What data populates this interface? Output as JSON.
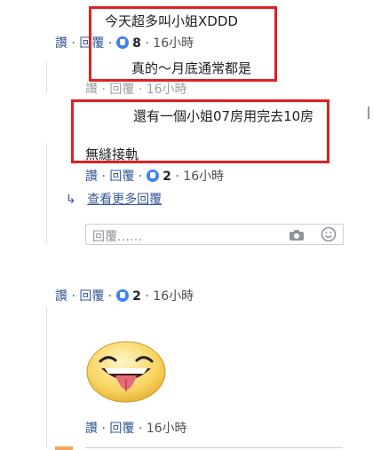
{
  "thread": {
    "comment1": {
      "text": "今天超多叫小姐XDDD",
      "meta": {
        "like": "讚",
        "reply": "回覆",
        "reactions": "8",
        "time": "16小時"
      }
    },
    "comment2": {
      "text": "真的～月底通常都是",
      "meta": {
        "like": "讚",
        "reply": "回覆",
        "time": "16小時"
      }
    },
    "comment3": {
      "text": "還有一個小姐07房用完去10房",
      "text2": "無縫接軌",
      "meta": {
        "like": "讚",
        "reply": "回覆",
        "reactions": "2",
        "time": "16小時"
      }
    },
    "more_replies": "查看更多回覆",
    "reply_input": {
      "placeholder": "回覆……"
    },
    "comment4": {
      "meta": {
        "like": "讚",
        "reply": "回覆",
        "reactions": "2",
        "time": "16小時"
      }
    },
    "comment5": {
      "sticker": "tongue-out-emoji",
      "meta": {
        "like": "讚",
        "reply": "回覆",
        "time": "16小時"
      }
    }
  },
  "colors": {
    "highlight": "#e02020",
    "link": "#385898",
    "reaction": "#4080ff"
  }
}
